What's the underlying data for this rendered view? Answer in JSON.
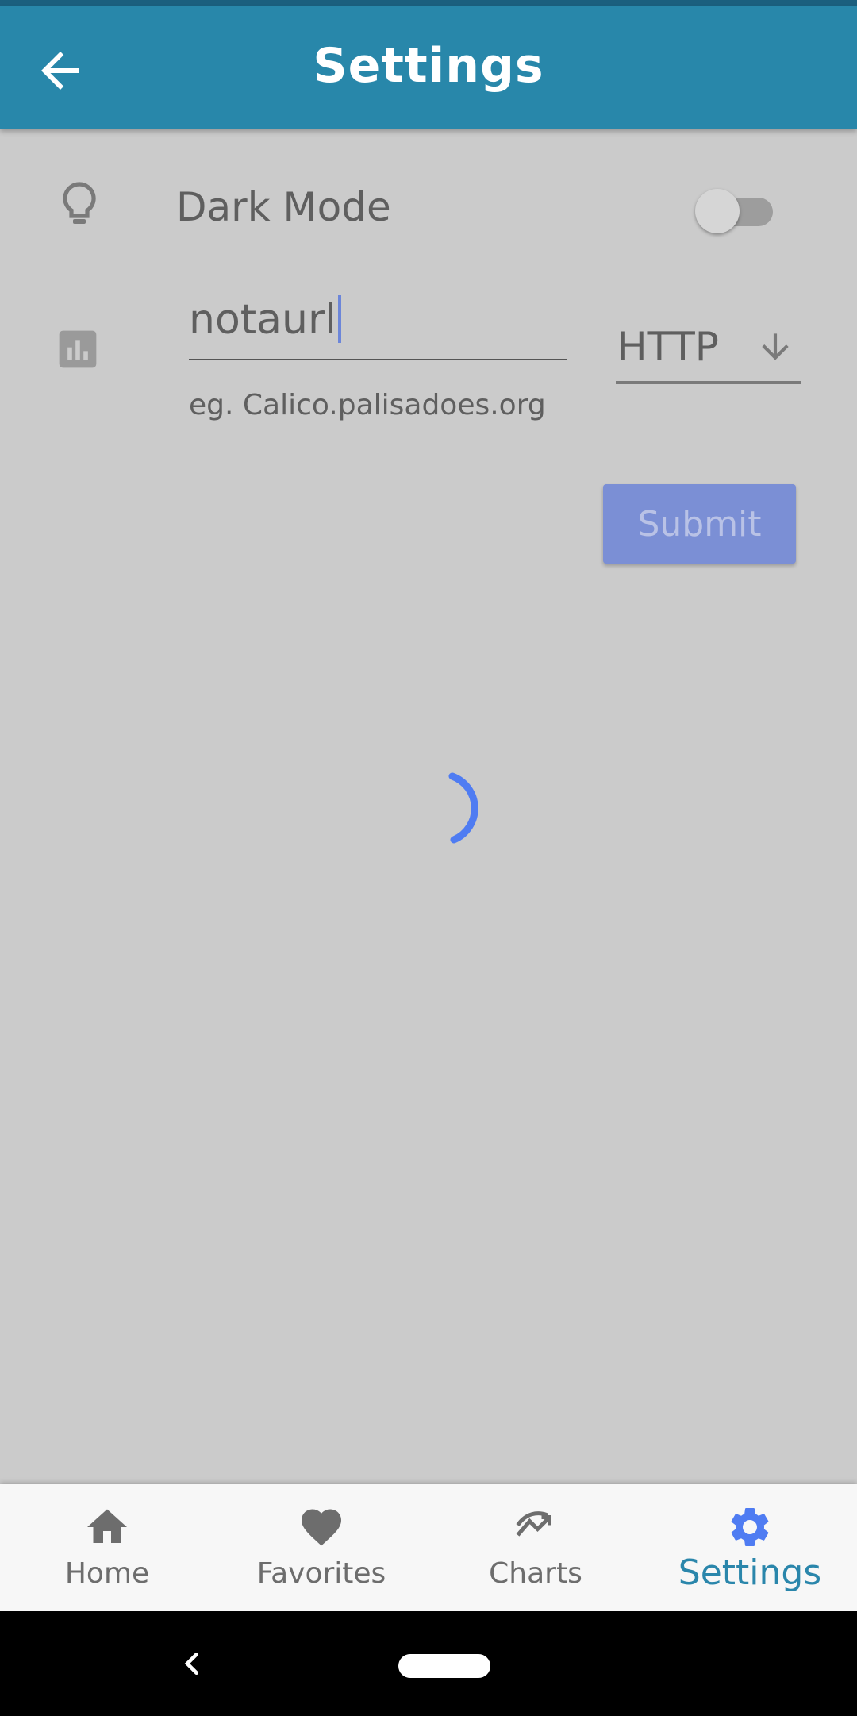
{
  "appbar": {
    "title": "Settings",
    "back_icon": "arrow-left-icon"
  },
  "settings": {
    "dark_mode": {
      "icon": "lightbulb-icon",
      "label": "Dark Mode",
      "enabled": false
    },
    "server": {
      "icon": "bar-chart-icon",
      "url_value": "notaurl",
      "url_helper": "eg. Calico.palisadoes.org",
      "protocol": "HTTP",
      "protocol_icon": "arrow-down-icon"
    },
    "submit_label": "Submit"
  },
  "loading": {
    "icon": "spinner-icon"
  },
  "bottom_nav": {
    "items": [
      {
        "label": "Home",
        "icon": "home-icon",
        "active": false
      },
      {
        "label": "Favorites",
        "icon": "heart-icon",
        "active": false
      },
      {
        "label": "Charts",
        "icon": "trending-icon",
        "active": false
      },
      {
        "label": "Settings",
        "icon": "gear-icon",
        "active": true
      }
    ]
  },
  "colors": {
    "appbar": "#2887aa",
    "accent": "#2a86ab",
    "submit": "#7b8fd5",
    "spinner": "#4f7cf2"
  }
}
